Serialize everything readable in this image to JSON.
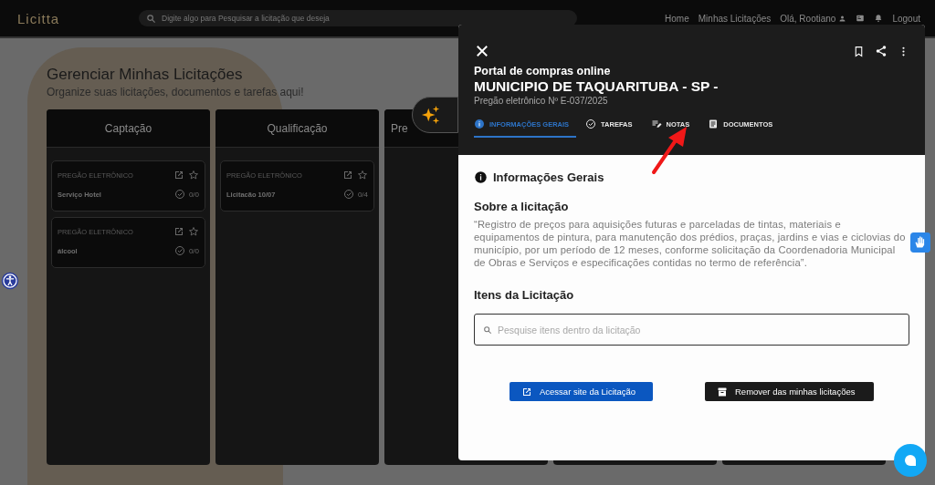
{
  "nav": {
    "logo": "Licitta",
    "search_placeholder": "Digite algo para Pesquisar a licitação que deseja",
    "links": [
      "Home",
      "Minhas Licitações"
    ],
    "user": "Olá, Rootiano",
    "logout": "Logout"
  },
  "page": {
    "title": "Gerenciar Minhas Licitações",
    "subtitle": "Organize suas licitações, documentos e tarefas aqui!"
  },
  "columns": [
    {
      "title": "Captação",
      "cards": [
        {
          "type": "PREGÃO ELETRÔNICO",
          "name": "Serviço Hotel",
          "tasks": "0/0"
        },
        {
          "type": "PREGÃO ELETRÔNICO",
          "name": "álcool",
          "tasks": "0/0"
        }
      ]
    },
    {
      "title": "Qualificação",
      "cards": [
        {
          "type": "PREGÃO ELETRÔNICO",
          "name": "Licitacão 10/07",
          "tasks": "0/4"
        }
      ]
    },
    {
      "title": "Pre"
    },
    {},
    {}
  ],
  "modal": {
    "portal": "Portal de compras online",
    "agency": "MUNICIPIO DE TAQUARITUBA - SP -",
    "process": "Pregão eletrônico Nº E-037/2025",
    "tabs": [
      {
        "label": "INFORMAÇÕES GERAIS",
        "kind": "info",
        "selected": true
      },
      {
        "label": "TAREFAS",
        "kind": "tasks",
        "selected": false
      },
      {
        "label": "NOTAS",
        "kind": "notes",
        "selected": false
      },
      {
        "label": "DOCUMENTOS",
        "kind": "docs",
        "selected": false
      }
    ],
    "section_title": "Informações Gerais",
    "about_title": "Sobre a licitação",
    "about_text": "“Registro de preços para aquisições futuras e parceladas de tintas, materiais e equipamentos de pintura, para manutenção dos prédios, praças, jardins e vias e ciclovias do município, por um período de 12 meses, conforme solicitação da Coordenadoria Municipal de Obras e Serviços e especificações contidas no termo de referência”.",
    "items_title": "Itens da Licitação",
    "items_search_placeholder": "Pesquise itens dentro da licitação",
    "buttons": [
      {
        "label": "Acessar site da Licitação",
        "kind": "primary"
      },
      {
        "label": "Remover das minhas licitações",
        "kind": "dark"
      }
    ]
  }
}
